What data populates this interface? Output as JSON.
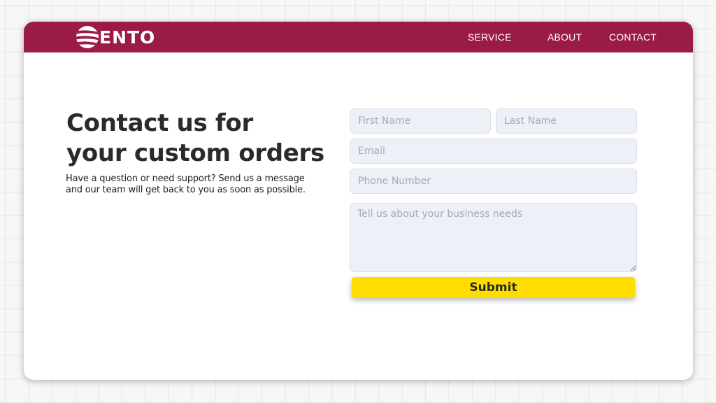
{
  "colors": {
    "navbar": "#9b1b48",
    "submit": "#ffdd00",
    "field_bg": "#eef0f8",
    "text": "#2a2a2a"
  },
  "brand": {
    "logo_icon": "striped-globe-icon",
    "name": "ENTO"
  },
  "nav": {
    "items": [
      {
        "label": "SERVICE"
      },
      {
        "label": "ABOUT"
      },
      {
        "label": "CONTACT"
      }
    ]
  },
  "hero": {
    "title_line1": "Contact us for",
    "title_line2": "your custom orders",
    "subtext_line1": "Have a question or need support? Send us a message",
    "subtext_line2": "and our team will get back to you as soon as possible."
  },
  "form": {
    "first_name": {
      "placeholder": "First Name",
      "value": ""
    },
    "last_name": {
      "placeholder": "Last Name",
      "value": ""
    },
    "email": {
      "placeholder": "Email",
      "value": ""
    },
    "phone": {
      "placeholder": "Phone Number",
      "value": ""
    },
    "message": {
      "placeholder": "Tell us about your business needs",
      "value": ""
    },
    "submit_label": "Submit"
  }
}
